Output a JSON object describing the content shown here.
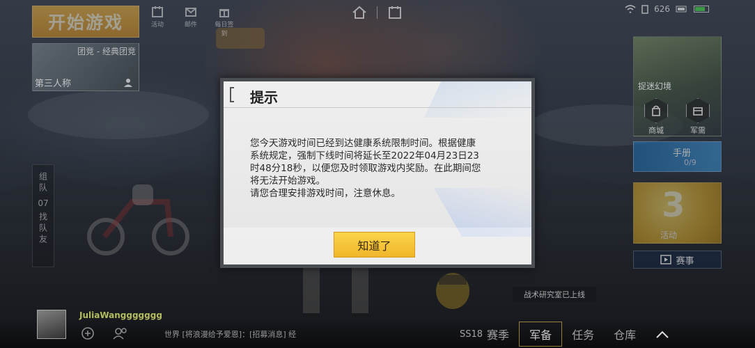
{
  "top_left": {
    "start_game": "开始游戏",
    "mode_name": "团竞 - 经典团竞",
    "perspective": "第三人称"
  },
  "top_icons": [
    {
      "name": "event-icon",
      "label": "活动"
    },
    {
      "name": "mail-icon",
      "label": "邮件"
    },
    {
      "name": "gift-icon",
      "label": "每日签到"
    }
  ],
  "status": {
    "ping": "626",
    "battery_level": 0.7
  },
  "team_panel": {
    "team_label": "组队",
    "team_number": "07",
    "find_team": "找队友"
  },
  "right_panel": {
    "shop_title": "捉迷幻境",
    "shop_item_1": "商城",
    "shop_item_2": "军需",
    "handbook_title": "手册",
    "handbook_progress": "0/9",
    "event_number": "3",
    "event_label": "活动",
    "match_button": "赛事",
    "lab_tag": "战术研究室已上线"
  },
  "user": {
    "username": "JuliaWanggggggg",
    "chat_line": "世界 [将浪漫给予爱恩]：[招募消息] 经"
  },
  "bottom_tabs": [
    {
      "label": "赛季",
      "sub": "SS18"
    },
    {
      "label": "军备"
    },
    {
      "label": "任务"
    },
    {
      "label": "仓库"
    }
  ],
  "modal": {
    "title": "提示",
    "body_lines": [
      "您今天游戏时间已经到达健康系统限制时间。根据健康",
      "系统规定，强制下线时间将延长至2022年04月23日23",
      "时48分18秒，以便您及时领取游戏内奖励。在此期间您",
      "将无法开始游戏。",
      "请您合理安排游戏时间，注意休息。"
    ],
    "ok_button": "知道了"
  }
}
